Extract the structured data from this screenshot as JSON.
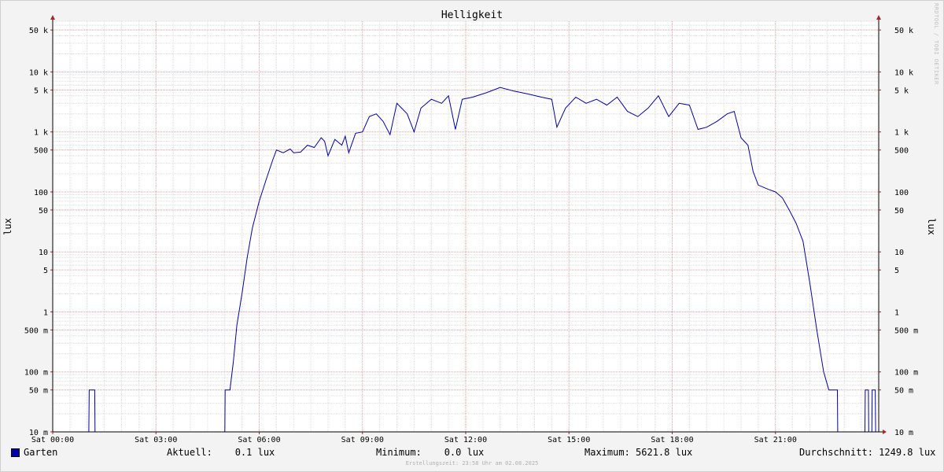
{
  "chart_data": {
    "type": "line",
    "title": "Helligkeit",
    "ylabel": "lux",
    "ylabel_right": "lux",
    "scale": "log",
    "ylim": [
      0.01,
      70000
    ],
    "x_ticks": [
      "Sat 00:00",
      "Sat 03:00",
      "Sat 06:00",
      "Sat 09:00",
      "Sat 12:00",
      "Sat 15:00",
      "Sat 18:00",
      "Sat 21:00"
    ],
    "y_ticks": [
      {
        "value": 50000,
        "label": "50 k"
      },
      {
        "value": 10000,
        "label": "10 k"
      },
      {
        "value": 5000,
        "label": "5 k"
      },
      {
        "value": 1000,
        "label": "1 k"
      },
      {
        "value": 500,
        "label": "500"
      },
      {
        "value": 100,
        "label": "100"
      },
      {
        "value": 50,
        "label": "50"
      },
      {
        "value": 10,
        "label": "10"
      },
      {
        "value": 5,
        "label": "5"
      },
      {
        "value": 1,
        "label": "1"
      },
      {
        "value": 0.5,
        "label": "500 m"
      },
      {
        "value": 0.1,
        "label": "100 m"
      },
      {
        "value": 0.05,
        "label": "50 m"
      },
      {
        "value": 0.01,
        "label": "10 m"
      }
    ],
    "grid": true,
    "series": [
      {
        "name": "Garten",
        "color": "#0000aa",
        "points": [
          [
            0.0,
            0.01
          ],
          [
            1.05,
            0.01
          ],
          [
            1.06,
            0.05
          ],
          [
            1.22,
            0.05
          ],
          [
            1.23,
            0.01
          ],
          [
            5.0,
            0.01
          ],
          [
            5.01,
            0.05
          ],
          [
            5.15,
            0.05
          ],
          [
            5.25,
            0.15
          ],
          [
            5.35,
            0.6
          ],
          [
            5.5,
            2.0
          ],
          [
            5.65,
            8.0
          ],
          [
            5.8,
            25
          ],
          [
            6.0,
            70
          ],
          [
            6.2,
            160
          ],
          [
            6.4,
            350
          ],
          [
            6.5,
            500
          ],
          [
            6.7,
            450
          ],
          [
            6.9,
            520
          ],
          [
            7.0,
            450
          ],
          [
            7.2,
            460
          ],
          [
            7.4,
            600
          ],
          [
            7.6,
            550
          ],
          [
            7.8,
            800
          ],
          [
            7.9,
            700
          ],
          [
            8.0,
            400
          ],
          [
            8.2,
            750
          ],
          [
            8.4,
            600
          ],
          [
            8.5,
            850
          ],
          [
            8.6,
            450
          ],
          [
            8.8,
            950
          ],
          [
            9.0,
            1000
          ],
          [
            9.2,
            1800
          ],
          [
            9.4,
            2000
          ],
          [
            9.6,
            1500
          ],
          [
            9.8,
            900
          ],
          [
            10.0,
            3000
          ],
          [
            10.3,
            2000
          ],
          [
            10.5,
            1000
          ],
          [
            10.7,
            2500
          ],
          [
            11.0,
            3500
          ],
          [
            11.3,
            3000
          ],
          [
            11.5,
            4000
          ],
          [
            11.7,
            1100
          ],
          [
            11.9,
            3500
          ],
          [
            12.2,
            3800
          ],
          [
            12.6,
            4500
          ],
          [
            13.0,
            5500
          ],
          [
            13.4,
            4800
          ],
          [
            13.8,
            4300
          ],
          [
            14.2,
            3800
          ],
          [
            14.5,
            3500
          ],
          [
            14.65,
            1200
          ],
          [
            14.9,
            2500
          ],
          [
            15.2,
            3800
          ],
          [
            15.5,
            3000
          ],
          [
            15.8,
            3500
          ],
          [
            16.1,
            2800
          ],
          [
            16.4,
            3800
          ],
          [
            16.7,
            2200
          ],
          [
            17.0,
            1800
          ],
          [
            17.3,
            2500
          ],
          [
            17.6,
            4000
          ],
          [
            17.9,
            1800
          ],
          [
            18.2,
            3000
          ],
          [
            18.5,
            2800
          ],
          [
            18.75,
            1100
          ],
          [
            19.0,
            1200
          ],
          [
            19.3,
            1500
          ],
          [
            19.6,
            2000
          ],
          [
            19.8,
            2200
          ],
          [
            20.0,
            800
          ],
          [
            20.2,
            600
          ],
          [
            20.35,
            220
          ],
          [
            20.5,
            130
          ],
          [
            20.8,
            110
          ],
          [
            21.0,
            100
          ],
          [
            21.2,
            80
          ],
          [
            21.4,
            50
          ],
          [
            21.6,
            30
          ],
          [
            21.8,
            15
          ],
          [
            22.0,
            3.0
          ],
          [
            22.2,
            0.5
          ],
          [
            22.4,
            0.1
          ],
          [
            22.55,
            0.05
          ],
          [
            22.8,
            0.05
          ],
          [
            22.81,
            0.01
          ],
          [
            23.6,
            0.01
          ],
          [
            23.61,
            0.05
          ],
          [
            23.7,
            0.05
          ],
          [
            23.71,
            0.01
          ],
          [
            23.8,
            0.01
          ],
          [
            23.81,
            0.05
          ],
          [
            23.9,
            0.05
          ],
          [
            23.91,
            0.01
          ],
          [
            24.0,
            0.01
          ]
        ]
      }
    ]
  },
  "legend": {
    "series_name": "Garten",
    "current": "Aktuell:    0.1 lux",
    "minimum": "Minimum:    0.0 lux",
    "maximum": "Maximum: 5621.8 lux",
    "average": "Durchschnitt: 1249.8 lux"
  },
  "footer": "Erstellungszeit: 23:58 Uhr am 02.08.2025",
  "vendor": "RRDTOOL / TOBI OETIKER"
}
